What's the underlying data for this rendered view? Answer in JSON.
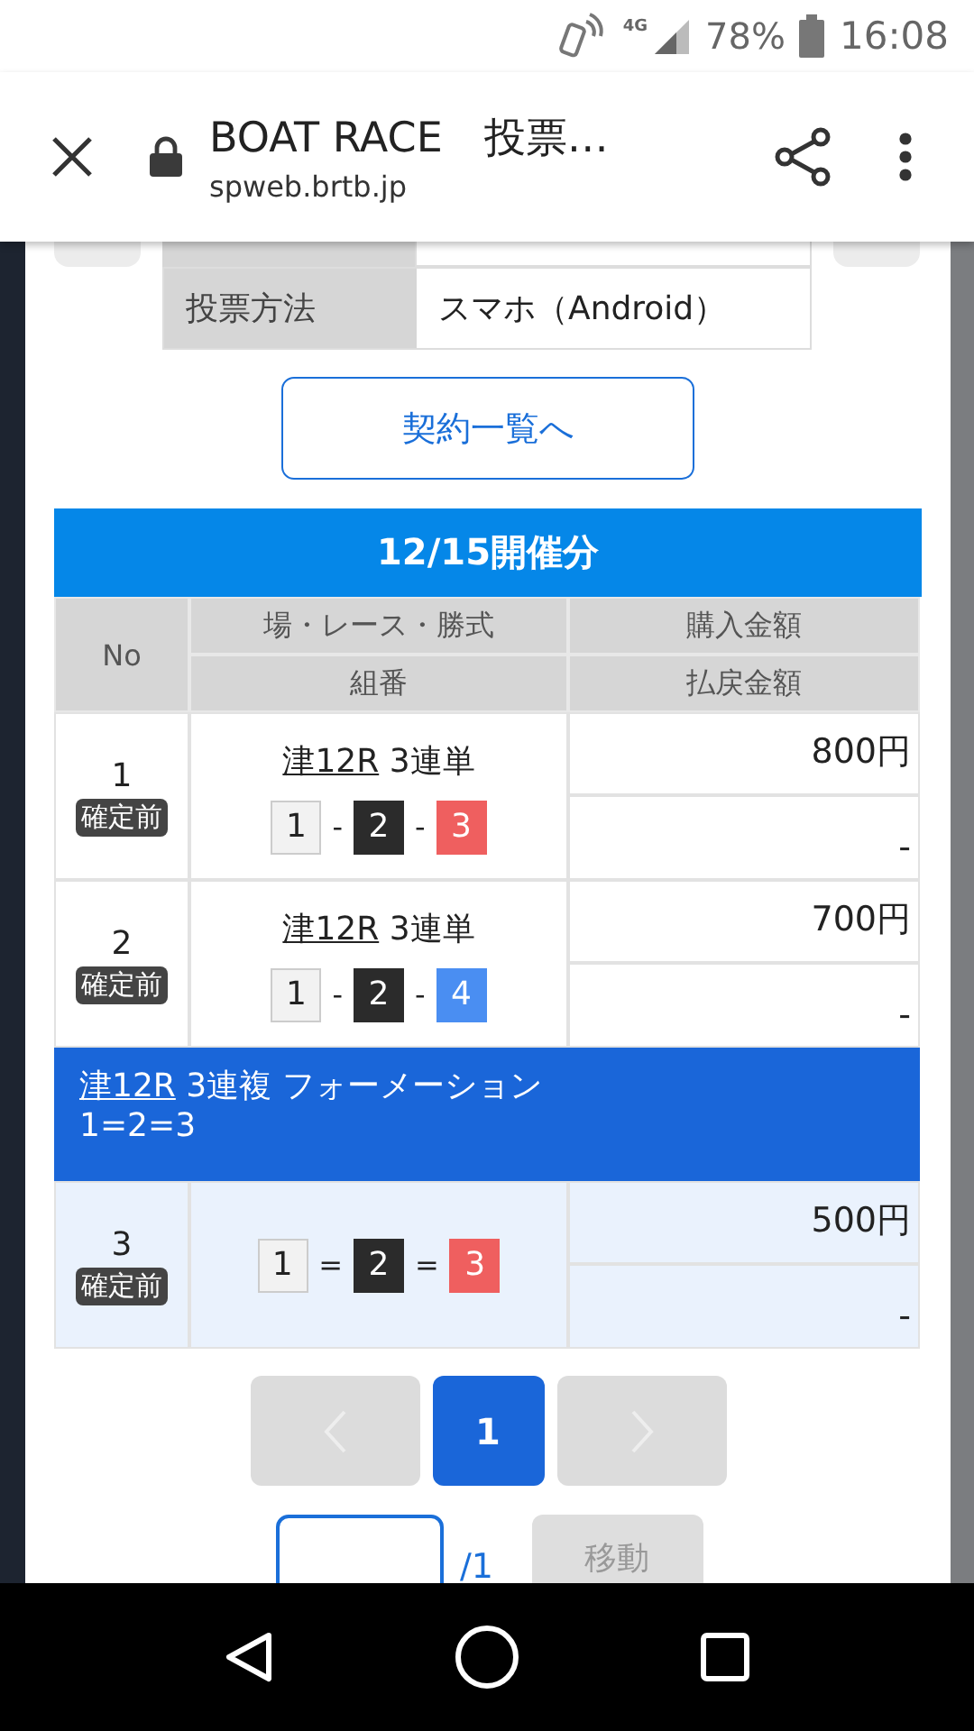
{
  "status_bar": {
    "network": "4G",
    "battery": "78%",
    "time": "16:08"
  },
  "browser": {
    "title": "BOAT RACE　投票…",
    "url": "spweb.brtb.jp"
  },
  "info_table": [
    {
      "label": "投票方法",
      "value": "スマホ（Android）"
    }
  ],
  "contracts_button": "契約一覧へ",
  "section": {
    "title": "12/15開催分",
    "columns": {
      "no": "No",
      "race": "場・レース・勝式",
      "combo": "組番",
      "purchase": "購入金額",
      "payout": "払戻金額"
    },
    "rows": [
      {
        "kind": "bet",
        "highlighted": false,
        "no": "1",
        "status": "確定前",
        "race": "津12R",
        "bet_type": "3連単",
        "separator": "-",
        "combo": [
          {
            "number": "1",
            "color": "#f2f2f2"
          },
          {
            "number": "2",
            "color": "#2b2b2b"
          },
          {
            "number": "3",
            "color": "#ef5f5f"
          }
        ],
        "purchase": "800円",
        "payout": "-"
      },
      {
        "kind": "bet",
        "highlighted": false,
        "no": "2",
        "status": "確定前",
        "race": "津12R",
        "bet_type": "3連単",
        "separator": "-",
        "combo": [
          {
            "number": "1",
            "color": "#f2f2f2"
          },
          {
            "number": "2",
            "color": "#2b2b2b"
          },
          {
            "number": "4",
            "color": "#4a8ef2"
          }
        ],
        "purchase": "700円",
        "payout": "-"
      },
      {
        "kind": "group",
        "race": "津12R",
        "bet_type": "3連複 フォーメーション",
        "formula": "1=2=3"
      },
      {
        "kind": "bet",
        "highlighted": true,
        "no": "3",
        "status": "確定前",
        "separator": "=",
        "combo": [
          {
            "number": "1",
            "color": "#f2f2f2"
          },
          {
            "number": "2",
            "color": "#2b2b2b"
          },
          {
            "number": "3",
            "color": "#ef5f5f"
          }
        ],
        "purchase": "500円",
        "payout": "-"
      }
    ]
  },
  "pagination": {
    "prev": {
      "disabled": true
    },
    "pages": [
      {
        "label": "1",
        "selected": true
      }
    ],
    "next": {
      "disabled": true
    }
  },
  "page_jump": {
    "total": "/1",
    "button": "移動",
    "disabled": true
  }
}
